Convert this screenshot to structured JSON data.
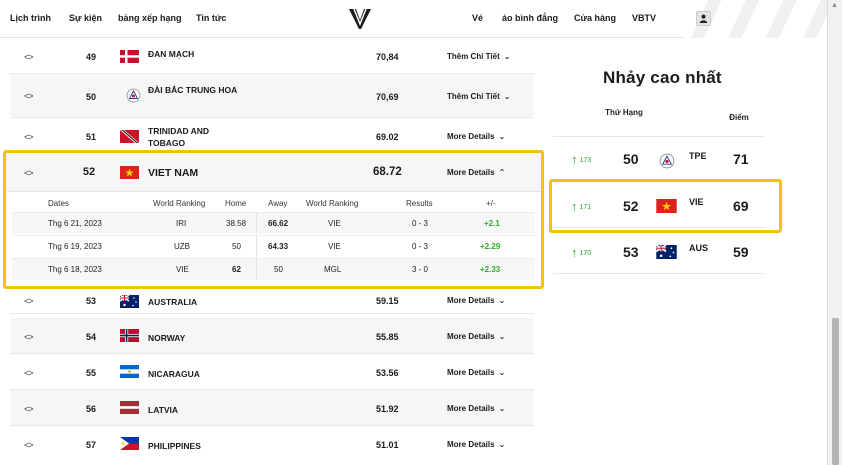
{
  "nav": {
    "left_links": [
      "Lịch trình",
      "Sự kiện",
      "bảng xếp hạng",
      "Tin tức"
    ],
    "right_links": [
      "Vé",
      "áo bình đẳng",
      "Cửa hàng",
      "VBTV"
    ],
    "logo_icon": "volleyball-world-logo-icon",
    "user_icon": "user-icon"
  },
  "ranking_table": {
    "expand_icon": "<>",
    "rows": [
      {
        "rank": "49",
        "country": "ĐAN MẠCH",
        "points": "70,84",
        "more": "Thêm Chi Tiết",
        "flag": "denmark"
      },
      {
        "rank": "50",
        "country": "ĐÀI BẮC TRUNG HOA",
        "points": "70,69",
        "more": "Thêm Chi Tiết",
        "flag": "chinese-taipei"
      },
      {
        "rank": "51",
        "country": "TRINIDAD AND TOBAGO",
        "points": "69.02",
        "more": "More Details",
        "flag": "trinidad"
      },
      {
        "rank": "52",
        "country": "VIET NAM",
        "points": "68.72",
        "more": "More Details",
        "flag": "vietnam"
      },
      {
        "rank": "53",
        "country": "AUSTRALIA",
        "points": "59.15",
        "more": "More Details",
        "flag": "australia"
      },
      {
        "rank": "54",
        "country": "NORWAY",
        "points": "55.85",
        "more": "More Details",
        "flag": "norway"
      },
      {
        "rank": "55",
        "country": "NICARAGUA",
        "points": "53.56",
        "more": "More Details",
        "flag": "nicaragua"
      },
      {
        "rank": "56",
        "country": "LATVIA",
        "points": "51.92",
        "more": "More Details",
        "flag": "latvia"
      },
      {
        "rank": "57",
        "country": "PHILIPPINES",
        "points": "51.01",
        "more": "More Details",
        "flag": "philippines"
      }
    ],
    "detail_headers": [
      "Dates",
      "World Ranking",
      "Home",
      "Away",
      "World Ranking",
      "Results",
      "+/-"
    ],
    "matches": [
      {
        "date": "Thg 6 21, 2023",
        "home_team": "IRI",
        "home": "38.58",
        "away": "66.62",
        "away_team": "VIE",
        "result": "0 - 3",
        "diff": "+2.1"
      },
      {
        "date": "Thg 6 19, 2023",
        "home_team": "UZB",
        "home": "50",
        "away": "64.33",
        "away_team": "VIE",
        "result": "0 - 3",
        "diff": "+2.29"
      },
      {
        "date": "Thg 6 18, 2023",
        "home_team": "VIE",
        "home": "62",
        "away": "50",
        "away_team": "MGL",
        "result": "3 - 0",
        "diff": "+2.33"
      }
    ]
  },
  "side_panel": {
    "title": "Nhảy cao nhất",
    "col_rank": "Thứ Hạng",
    "col_score": "Điểm",
    "rows": [
      {
        "prev": "173",
        "rank": "50",
        "code": "TPE",
        "score": "71",
        "flag": "chinese-taipei"
      },
      {
        "prev": "171",
        "rank": "52",
        "code": "VIE",
        "score": "69",
        "flag": "vietnam"
      },
      {
        "prev": "170",
        "rank": "53",
        "code": "AUS",
        "score": "59",
        "flag": "australia"
      }
    ]
  },
  "colors": {
    "highlight": "#f4c20d",
    "positive": "#2eaa2e"
  }
}
